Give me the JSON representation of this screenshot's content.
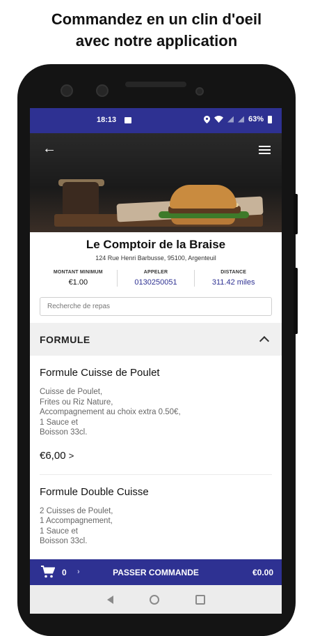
{
  "headline": {
    "line1": "Commandez en un clin d'oeil",
    "line2": "avec notre application"
  },
  "statusbar": {
    "time": "18:13",
    "battery": "63%",
    "icons": [
      "image-icon",
      "location-icon",
      "wifi-icon",
      "signal-icon",
      "signal-icon",
      "battery-icon"
    ]
  },
  "header": {
    "back_icon": "arrow-left-icon",
    "menu_icon": "hamburger-menu-icon"
  },
  "restaurant": {
    "name": "Le Comptoir de la Braise",
    "address": "124 Rue Henri Barbusse, 95100, Argenteuil",
    "infos": [
      {
        "label": "MONTANT MINIMUM",
        "value": "€1.00"
      },
      {
        "label": "APPELER",
        "value": "0130250051"
      },
      {
        "label": "DISTANCE",
        "value": "311.42  miles"
      }
    ]
  },
  "search": {
    "placeholder": "Recherche de repas"
  },
  "section": {
    "title": "FORMULE",
    "expanded": true
  },
  "menu_items": [
    {
      "name": "Formule Cuisse de Poulet",
      "description": "Cuisse de Poulet,\nFrites ou Riz Nature,\nAccompagnement au choix extra 0.50€,\n1 Sauce et\nBoisson 33cl.",
      "price": "€6,00",
      "price_arrow": ">"
    },
    {
      "name": "Formule Double Cuisse",
      "description": "2 Cuisses de Poulet,\n1 Accompagnement,\n1 Sauce et\nBoisson 33cl."
    }
  ],
  "order_bar": {
    "count": "0",
    "label": "PASSER COMMANDE",
    "total": "€0.00"
  },
  "navigation": [
    "back-triangle-icon",
    "home-circle-icon",
    "recents-square-icon"
  ],
  "colors": {
    "brand": "#2e3192",
    "section_bg": "#f0f0f0"
  }
}
